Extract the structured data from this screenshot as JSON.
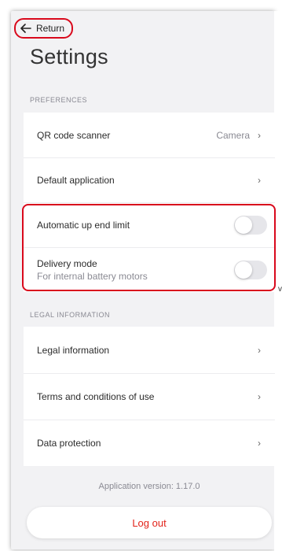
{
  "header": {
    "back_label": "Return",
    "title": "Settings"
  },
  "preferences": {
    "section_label": "PREFERENCES",
    "items": [
      {
        "label": "QR code scanner",
        "value": "Camera",
        "chevron": "›"
      },
      {
        "label": "Default application",
        "chevron": "›"
      }
    ],
    "toggles": [
      {
        "label": "Automatic up end limit",
        "on": false
      },
      {
        "label": "Delivery mode",
        "sublabel": "For internal battery motors",
        "on": false
      }
    ]
  },
  "legal": {
    "section_label": "LEGAL INFORMATION",
    "items": [
      {
        "label": "Legal information",
        "chevron": "›"
      },
      {
        "label": "Terms and conditions of use",
        "chevron": "›"
      },
      {
        "label": "Data protection",
        "chevron": "›"
      }
    ]
  },
  "footer": {
    "version": "Application version: 1.17.0",
    "logout_label": "Log out"
  },
  "stray_text": "v",
  "colors": {
    "accent_red": "#d9091c",
    "logout_red": "#e2231a",
    "background": "#f2f2f4"
  }
}
